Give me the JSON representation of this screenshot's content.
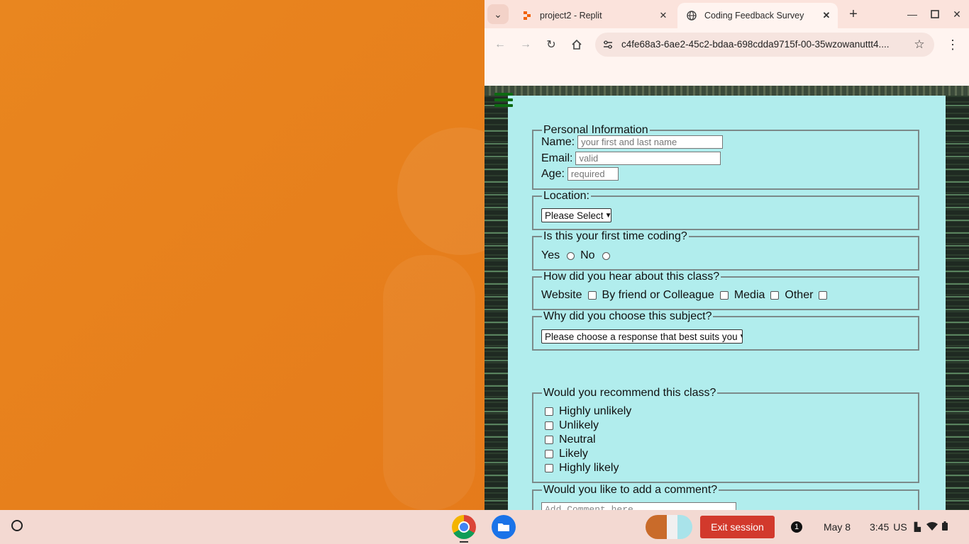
{
  "browser": {
    "tabs": [
      {
        "title": "project2 - Replit",
        "active": false,
        "icon": "replit-icon"
      },
      {
        "title": "Coding Feedback Survey",
        "active": true,
        "icon": "globe-icon"
      }
    ],
    "url": "c4fe68a3-6ae2-45c2-bdaa-698cdda9715f-00-35wzowanuttt4...."
  },
  "form": {
    "personal": {
      "legend": "Personal Information",
      "name_label": "Name:",
      "name_placeholder": "your first and last name",
      "email_label": "Email:",
      "email_placeholder": "valid",
      "age_label": "Age:",
      "age_placeholder": "required"
    },
    "location": {
      "legend": "Location:",
      "select_value": "Please Select"
    },
    "first_time": {
      "legend": "Is this your first time coding?",
      "options": [
        "Yes",
        "No"
      ]
    },
    "heard": {
      "legend": "How did you hear about this class?",
      "options": [
        "Website",
        "By friend or Colleague",
        "Media",
        "Other"
      ]
    },
    "why": {
      "legend": "Why did you choose this subject?",
      "select_value": "Please choose a response that best suits you"
    },
    "recommend": {
      "legend": "Would you recommend this class?",
      "options": [
        "Highly unlikely",
        "Unlikely",
        "Neutral",
        "Likely",
        "Highly likely"
      ]
    },
    "comment": {
      "legend": "Would you like to add a comment?",
      "placeholder": "Add Comment here"
    }
  },
  "shelf": {
    "exit_label": "Exit session",
    "notification_count": "1",
    "date": "May 8",
    "time": "3:45",
    "locale": "US"
  },
  "colors": {
    "page_panel": "#b1eded",
    "exit_button": "#d2392c",
    "wallpaper": "#e8821e"
  }
}
